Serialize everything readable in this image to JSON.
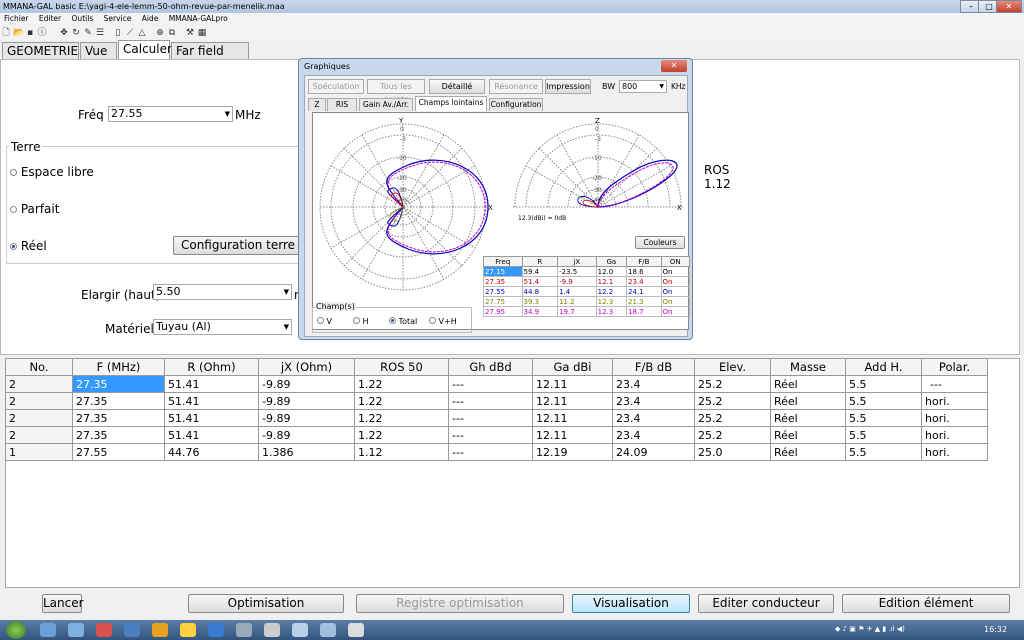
{
  "window": {
    "title": "MMANA-GAL basic E:\\yagi-4-ele-lemm-50-ohm-revue-par-menelik.maa",
    "min": "–",
    "max": "□",
    "close": "✕"
  },
  "menu": [
    "Fichier",
    "Editer",
    "Outils",
    "Service",
    "Aide",
    "MMANA-GALpro"
  ],
  "tabs": [
    "GEOMETRIE",
    "Vue",
    "Calculer",
    "Far field plots"
  ],
  "calc": {
    "freq_label": "Fréq",
    "freq_value": "27.55",
    "freq_unit": "MHz",
    "terre_group": "Terre",
    "ground_options": [
      "Espace libre",
      "Parfait",
      "Réel"
    ],
    "config_terre": "Configuration terre",
    "elargir_label": "Elargir (haut)",
    "elargir_value": "5.50",
    "elargir_unit": "m",
    "materiel_label": "Matériel",
    "materiel_value": "Tuyau (Al)",
    "ros_label": "ROS",
    "ros_value": "1.12"
  },
  "grid": {
    "headers": [
      "No.",
      "F (MHz)",
      "R (Ohm)",
      "jX (Ohm)",
      "ROS  50",
      "Gh dBd",
      "Ga dBi",
      "F/B dB",
      "Elev.",
      "Masse",
      "Add H.",
      "Polar."
    ],
    "rows": [
      [
        "2",
        "27.35",
        "51.41",
        "-9.89",
        "1.22",
        "---",
        "12.11",
        "23.4",
        "25.2",
        "Réel",
        "5.5",
        "---"
      ],
      [
        "2",
        "27.35",
        "51.41",
        "-9.89",
        "1.22",
        "---",
        "12.11",
        "23.4",
        "25.2",
        "Réel",
        "5.5",
        "hori."
      ],
      [
        "2",
        "27.35",
        "51.41",
        "-9.89",
        "1.22",
        "---",
        "12.11",
        "23.4",
        "25.2",
        "Réel",
        "5.5",
        "hori."
      ],
      [
        "2",
        "27.35",
        "51.41",
        "-9.89",
        "1.22",
        "---",
        "12.11",
        "23.4",
        "25.2",
        "Réel",
        "5.5",
        "hori."
      ],
      [
        "1",
        "27.55",
        "44.76",
        "1.386",
        "1.12",
        "---",
        "12.19",
        "24.09",
        "25.0",
        "Réel",
        "5.5",
        "hori."
      ]
    ]
  },
  "bottom_buttons": [
    "Lancer",
    "Optimisation",
    "Registre optimisation",
    "Visualisation",
    "Editer conducteur",
    "Edition élément"
  ],
  "dialog": {
    "title": "Graphiques",
    "buttons": [
      "Spéculation",
      "Tous les points",
      "Détaillé",
      "Résonance",
      "Impression"
    ],
    "bw_label": "BW",
    "bw_value": "800",
    "bw_unit": "KHz",
    "tabs": [
      "Z",
      "RIS",
      "Gain Av./Arr.",
      "Champs lointains",
      "Configuration"
    ],
    "plot_left": {
      "top": "Y",
      "rings": [
        "0",
        "-3",
        "-10",
        "-20",
        "-30",
        "-40"
      ],
      "right": "X"
    },
    "plot_right": {
      "top": "Z",
      "rings": [
        "0",
        "-3",
        "-10",
        "-20",
        "-30",
        "-40"
      ],
      "right": "X",
      "note": "12.3(dBi) = 0dB"
    },
    "couleurs": "Couleurs",
    "table_headers": [
      "Freq",
      "R",
      "jX",
      "Ga",
      "F/B",
      "ON"
    ],
    "table_rows": [
      {
        "f": "27.15",
        "r": "59.4",
        "jx": "-23.5",
        "ga": "12.0",
        "fb": "18.6",
        "on": "On",
        "color": "#000000"
      },
      {
        "f": "27.35",
        "r": "51.4",
        "jx": "-9.9",
        "ga": "12.1",
        "fb": "23.4",
        "on": "On",
        "color": "#c00000"
      },
      {
        "f": "27.55",
        "r": "44.8",
        "jx": "1.4",
        "ga": "12.2",
        "fb": "24.1",
        "on": "On",
        "color": "#0000c0"
      },
      {
        "f": "27.75",
        "r": "39.3",
        "jx": "11.2",
        "ga": "12.3",
        "fb": "21.3",
        "on": "On",
        "color": "#808000"
      },
      {
        "f": "27.95",
        "r": "34.9",
        "jx": "19.7",
        "ga": "12.3",
        "fb": "18.7",
        "on": "On",
        "color": "#c000c0"
      }
    ],
    "champs_group": "Champ(s)",
    "champs_options": [
      "V",
      "H",
      "Total",
      "V+H"
    ]
  },
  "taskbar": {
    "time": "16:32"
  }
}
